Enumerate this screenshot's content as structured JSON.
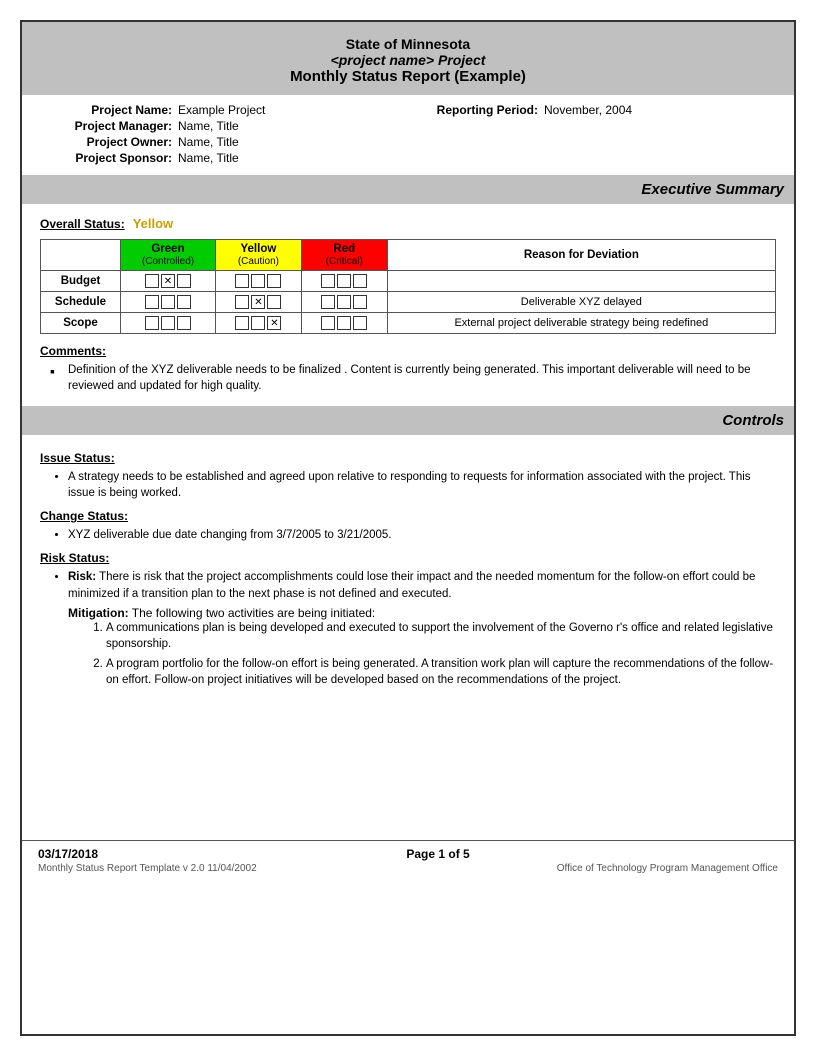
{
  "header": {
    "line1": "State of Minnesota",
    "line2": "<project name> Project",
    "line3": "Monthly Status Report (Example)"
  },
  "project": {
    "name_label": "Project Name:",
    "name_value": "Example Project",
    "reporting_period_label": "Reporting Period:",
    "reporting_period_value": "November, 2004",
    "manager_label": "Project Manager:",
    "manager_value": "Name, Title",
    "owner_label": "Project Owner:",
    "owner_value": "Name, Title",
    "sponsor_label": "Project Sponsor:",
    "sponsor_value": "Name, Title"
  },
  "executive_summary": {
    "title": "Executive Summary",
    "overall_status_label": "Overall Status:",
    "overall_status_value": "Yellow",
    "table": {
      "col_green_label": "Green",
      "col_green_sub": "(Controlled)",
      "col_yellow_label": "Yellow",
      "col_yellow_sub": "(Caution)",
      "col_red_label": "Red",
      "col_red_sub": "(Critical)",
      "col_reason_label": "Reason for Deviation",
      "rows": [
        {
          "label": "Budget",
          "green": [
            false,
            true,
            false
          ],
          "yellow": [
            false,
            false,
            false
          ],
          "red": [
            false,
            false,
            false
          ],
          "reason": ""
        },
        {
          "label": "Schedule",
          "green": [
            false,
            false,
            false
          ],
          "yellow": [
            false,
            true,
            false
          ],
          "red": [
            false,
            false,
            false
          ],
          "reason": "Deliverable  XYZ delayed"
        },
        {
          "label": "Scope",
          "green": [
            false,
            false,
            false
          ],
          "yellow": [
            false,
            false,
            true
          ],
          "red": [
            false,
            false,
            false
          ],
          "reason": "External project deliverable strategy being redefined"
        }
      ]
    },
    "comments_label": "Comments:",
    "comments": [
      "Definition of the XYZ deliverable  needs to be finalized .  Content is currently being generated.  This important deliverable will need to be reviewed and updated for high quality."
    ]
  },
  "controls": {
    "title": "Controls",
    "issue_status_label": "Issue Status:",
    "issue_items": [
      "A strategy needs to be established and agreed upon relative to  responding to  requests for information associated with the project.  This issue is being worked."
    ],
    "change_status_label": "Change Status:",
    "change_items": [
      "XYZ  deliverable due date changing from   3/7/2005 to 3/21/2005."
    ],
    "risk_status_label": "Risk Status:",
    "risk_label": "Risk:",
    "risk_text": "There is risk that the project accomplishments could lose their impact and the needed momentum for the follow-on effort could be   minimized if a transition plan to the next phase is not defined and executed.",
    "mitigation_label": "Mitigation:",
    "mitigation_intro": "The following two activities are being initiated:",
    "mitigation_items": [
      "A communications plan is being developed and executed to support the involvement of the Governo r's office and related legislative sponsorship.",
      "A program portfolio for the follow-on effort is being generated.  A transition work plan will capture the recommendations of the follow-on effort. Follow-on project initiatives will be developed based on the recommendations of the project."
    ]
  },
  "footer": {
    "date": "03/17/2018",
    "page": "Page 1 of 5",
    "template_info": "Monthly Status Report Template  v 2.0  11/04/2002",
    "office": "Office of Technology Program Management Office"
  }
}
